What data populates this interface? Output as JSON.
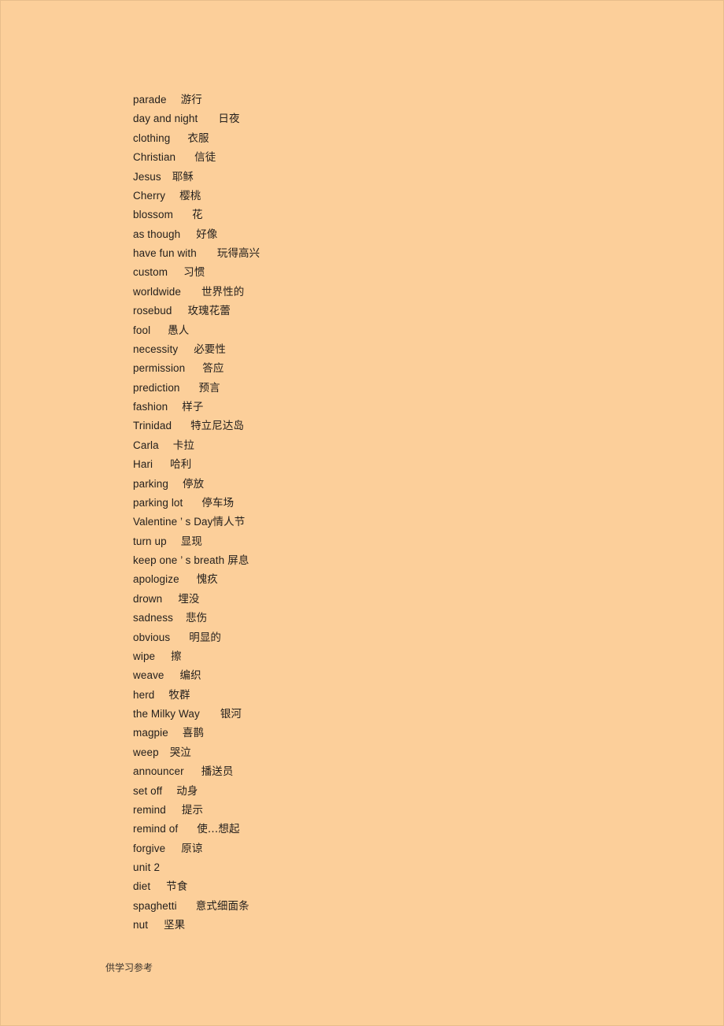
{
  "page": {
    "background_color": "#fccf9a",
    "text_color": "#231f1c",
    "border_color": "#e8bd8b"
  },
  "word_list": {
    "entries": [
      {
        "term": "parade",
        "gap": 18,
        "gloss": "游行"
      },
      {
        "term": "day and night",
        "gap": 26,
        "gloss": "日夜"
      },
      {
        "term": "clothing",
        "gap": 22,
        "gloss": "衣服"
      },
      {
        "term": "Christian",
        "gap": 24,
        "gloss": "信徒"
      },
      {
        "term": "Jesus",
        "gap": 14,
        "gloss": "耶稣"
      },
      {
        "term": "Cherry",
        "gap": 18,
        "gloss": "樱桃"
      },
      {
        "term": "blossom",
        "gap": 24,
        "gloss": "花"
      },
      {
        "term": "as though",
        "gap": 20,
        "gloss": "好像"
      },
      {
        "term": "have fun with",
        "gap": 26,
        "gloss": "玩得高兴"
      },
      {
        "term": "custom",
        "gap": 20,
        "gloss": "习惯"
      },
      {
        "term": "worldwide",
        "gap": 26,
        "gloss": "世界性的"
      },
      {
        "term": "rosebud",
        "gap": 20,
        "gloss": "玫瑰花蕾"
      },
      {
        "term": "fool",
        "gap": 22,
        "gloss": "愚人"
      },
      {
        "term": "necessity",
        "gap": 20,
        "gloss": "必要性"
      },
      {
        "term": "permission",
        "gap": 22,
        "gloss": "答应"
      },
      {
        "term": "prediction",
        "gap": 24,
        "gloss": "预言"
      },
      {
        "term": "fashion",
        "gap": 18,
        "gloss": "样子"
      },
      {
        "term": "Trinidad",
        "gap": 24,
        "gloss": "特立尼达岛"
      },
      {
        "term": "Carla",
        "gap": 18,
        "gloss": "卡拉"
      },
      {
        "term": "Hari",
        "gap": 22,
        "gloss": "哈利"
      },
      {
        "term": "parking",
        "gap": 18,
        "gloss": "停放"
      },
      {
        "term": "parking lot",
        "gap": 24,
        "gloss": "停车场"
      },
      {
        "term": "Valentine ’ s Day",
        "gap": 0,
        "gloss": "情人节"
      },
      {
        "term": "turn up",
        "gap": 18,
        "gloss": "显现"
      },
      {
        "term": "keep one ’ s breath",
        "gap": 4,
        "gloss": "屏息"
      },
      {
        "term": "apologize",
        "gap": 22,
        "gloss": "愧疚"
      },
      {
        "term": "drown",
        "gap": 20,
        "gloss": "埋没"
      },
      {
        "term": "sadness",
        "gap": 16,
        "gloss": "悲伤"
      },
      {
        "term": "obvious",
        "gap": 24,
        "gloss": "明显的"
      },
      {
        "term": "wipe",
        "gap": 20,
        "gloss": "擦"
      },
      {
        "term": "weave",
        "gap": 20,
        "gloss": "编织"
      },
      {
        "term": "herd",
        "gap": 18,
        "gloss": "牧群"
      },
      {
        "term": "the Milky Way",
        "gap": 26,
        "gloss": "银河"
      },
      {
        "term": "magpie",
        "gap": 18,
        "gloss": "喜鹊"
      },
      {
        "term": "weep",
        "gap": 14,
        "gloss": "哭泣"
      },
      {
        "term": "announcer",
        "gap": 22,
        "gloss": "播送员"
      },
      {
        "term": "set off",
        "gap": 18,
        "gloss": "动身"
      },
      {
        "term": "remind",
        "gap": 20,
        "gloss": "提示"
      },
      {
        "term": "remind of",
        "gap": 24,
        "gloss": "使…想起"
      },
      {
        "term": "forgive",
        "gap": 20,
        "gloss": "原谅"
      },
      {
        "term": "unit 2",
        "gap": 0,
        "gloss": ""
      },
      {
        "term": "diet",
        "gap": 20,
        "gloss": "节食"
      },
      {
        "term": "spaghetti",
        "gap": 24,
        "gloss": "意式细面条"
      },
      {
        "term": "nut",
        "gap": 20,
        "gloss": "坚果"
      }
    ]
  },
  "footer": {
    "note": "供学习参考"
  }
}
